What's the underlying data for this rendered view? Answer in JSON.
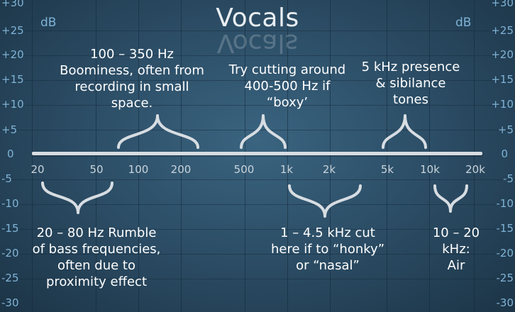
{
  "title": "Vocals",
  "db_unit": "dB",
  "db_ticks": [
    "+30",
    "+25",
    "+20",
    "+15",
    "+10",
    "+5",
    "0",
    "-5",
    "-10",
    "-15",
    "-20",
    "-25",
    "-30"
  ],
  "frequency_ticks": [
    "20",
    "50",
    "100",
    "200",
    "500",
    "1k",
    "2k",
    "5k",
    "10k",
    "20k"
  ],
  "annotations": {
    "boominess": [
      "100 – 350 Hz",
      "Boominess, often from",
      "recording in small",
      "space."
    ],
    "boxy": [
      "Try cutting around",
      "400-500 Hz if",
      "“boxy’"
    ],
    "presence": [
      "5 kHz presence",
      "& sibilance",
      "tones"
    ],
    "rumble": [
      "20 – 80 Hz Rumble",
      "of bass frequencies,",
      "often due to",
      "proximity effect"
    ],
    "honky": [
      "1 – 4.5 kHz cut",
      "here if to “honky”",
      "or “nasal”"
    ],
    "air": [
      "10 – 20",
      "kHz:",
      "Air"
    ]
  },
  "colors": {
    "background": "#2a4a62",
    "axis_labels": "#7fb3d6",
    "text": "#ffffff",
    "braces": "#d7dde2"
  }
}
